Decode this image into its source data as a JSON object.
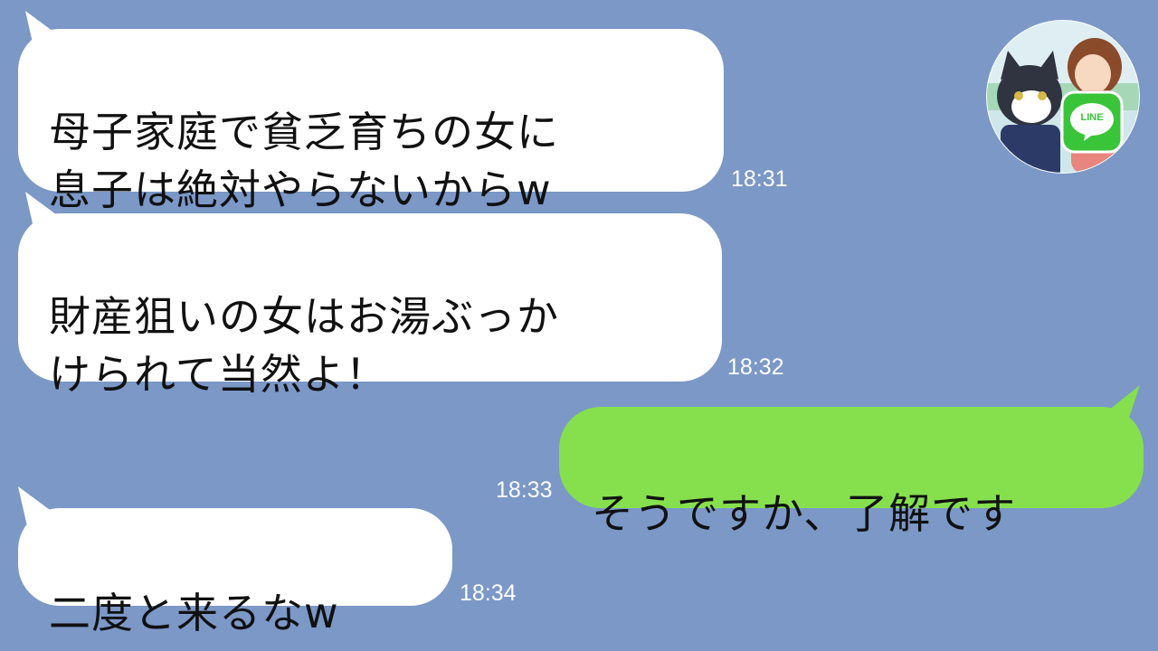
{
  "chat": {
    "messages": [
      {
        "sender": "other",
        "text": "母子家庭で貧乏育ちの女に\n息子は絶対やらないからw",
        "time": "18:31"
      },
      {
        "sender": "other",
        "text": "財産狙いの女はお湯ぶっか\nけられて当然よ！",
        "time": "18:32"
      },
      {
        "sender": "self",
        "text": "そうですか、了解です",
        "time": "18:33"
      },
      {
        "sender": "other",
        "text": "二度と来るなw",
        "time": "18:34"
      }
    ]
  },
  "avatar": {
    "badge_text": "LINE",
    "badge_color": "#3ac43a",
    "icon": "cat-and-woman-avatar"
  },
  "colors": {
    "background": "#7b98c7",
    "incoming_bubble": "#ffffff",
    "outgoing_bubble": "#86e04e"
  }
}
